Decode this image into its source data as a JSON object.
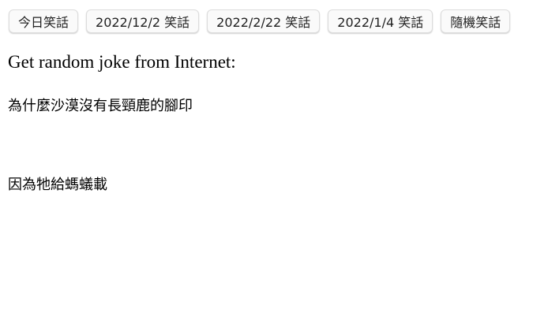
{
  "toolbar": {
    "buttons": [
      {
        "label": "今日笑話"
      },
      {
        "label": "2022/12/2 笑話"
      },
      {
        "label": "2022/2/22 笑話"
      },
      {
        "label": "2022/1/4 笑話"
      },
      {
        "label": "隨機笑話"
      }
    ]
  },
  "main": {
    "heading": "Get random joke from Internet:",
    "joke": {
      "question": "為什麼沙漠沒有長頸鹿的腳印",
      "answer": "因為牠給螞蟻載"
    }
  }
}
